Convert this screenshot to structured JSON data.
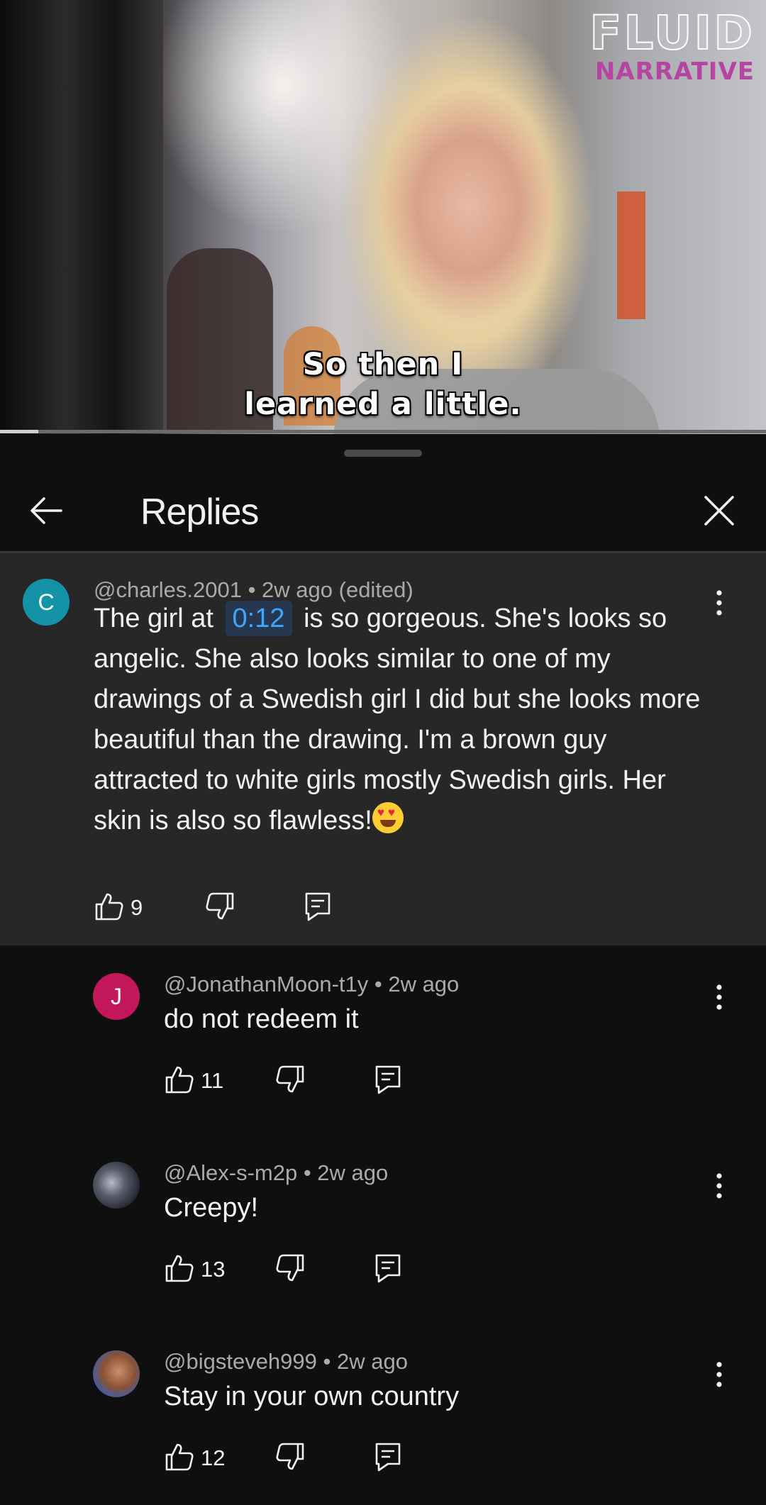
{
  "video": {
    "watermark_line1": "FLUID",
    "watermark_line2": "NARRATIVE",
    "subtitle_line1": "So then I",
    "subtitle_line2": "learned a little.",
    "progress_fraction": 0.05
  },
  "sheet": {
    "title": "Replies"
  },
  "parent_comment": {
    "avatar_letter": "C",
    "avatar_color": "#1493a6",
    "meta": "@charles.2001 • 2w ago (edited)",
    "text_before": "The girl at",
    "timestamp": "0:12",
    "text_after": "is so gorgeous. She's looks so angelic. She also looks similar to one of my drawings of a Swedish girl I did but she looks more beautiful than the drawing. I'm a brown guy attracted to white girls mostly Swedish girls. Her skin is also so flawless!",
    "emoji": "smiling-face-with-heart-eyes",
    "likes": "9"
  },
  "replies": [
    {
      "avatar_letter": "J",
      "avatar_color": "#c2185b",
      "meta": "@JonathanMoon-t1y • 2w ago",
      "text": "do not redeem it",
      "likes": "11"
    },
    {
      "avatar_letter": "",
      "avatar_color": "#3a3c42",
      "meta": "@Alex-s-m2p • 2w ago",
      "text": "Creepy!",
      "likes": "13"
    },
    {
      "avatar_letter": "",
      "avatar_color": "#7a4a32",
      "meta": "@bigsteveh999 • 2w ago",
      "text": "Stay in your own country",
      "likes": "12"
    }
  ]
}
